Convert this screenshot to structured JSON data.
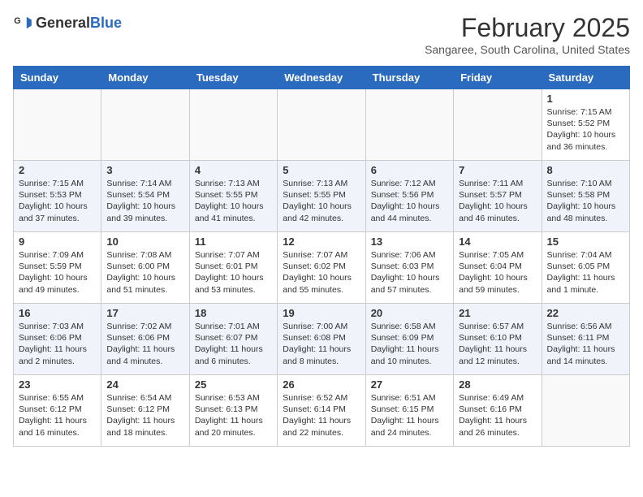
{
  "header": {
    "logo_general": "General",
    "logo_blue": "Blue",
    "month_year": "February 2025",
    "location": "Sangaree, South Carolina, United States"
  },
  "weekdays": [
    "Sunday",
    "Monday",
    "Tuesday",
    "Wednesday",
    "Thursday",
    "Friday",
    "Saturday"
  ],
  "weeks": [
    [
      {
        "day": "",
        "info": ""
      },
      {
        "day": "",
        "info": ""
      },
      {
        "day": "",
        "info": ""
      },
      {
        "day": "",
        "info": ""
      },
      {
        "day": "",
        "info": ""
      },
      {
        "day": "",
        "info": ""
      },
      {
        "day": "1",
        "info": "Sunrise: 7:15 AM\nSunset: 5:52 PM\nDaylight: 10 hours\nand 36 minutes."
      }
    ],
    [
      {
        "day": "2",
        "info": "Sunrise: 7:15 AM\nSunset: 5:53 PM\nDaylight: 10 hours\nand 37 minutes."
      },
      {
        "day": "3",
        "info": "Sunrise: 7:14 AM\nSunset: 5:54 PM\nDaylight: 10 hours\nand 39 minutes."
      },
      {
        "day": "4",
        "info": "Sunrise: 7:13 AM\nSunset: 5:55 PM\nDaylight: 10 hours\nand 41 minutes."
      },
      {
        "day": "5",
        "info": "Sunrise: 7:13 AM\nSunset: 5:55 PM\nDaylight: 10 hours\nand 42 minutes."
      },
      {
        "day": "6",
        "info": "Sunrise: 7:12 AM\nSunset: 5:56 PM\nDaylight: 10 hours\nand 44 minutes."
      },
      {
        "day": "7",
        "info": "Sunrise: 7:11 AM\nSunset: 5:57 PM\nDaylight: 10 hours\nand 46 minutes."
      },
      {
        "day": "8",
        "info": "Sunrise: 7:10 AM\nSunset: 5:58 PM\nDaylight: 10 hours\nand 48 minutes."
      }
    ],
    [
      {
        "day": "9",
        "info": "Sunrise: 7:09 AM\nSunset: 5:59 PM\nDaylight: 10 hours\nand 49 minutes."
      },
      {
        "day": "10",
        "info": "Sunrise: 7:08 AM\nSunset: 6:00 PM\nDaylight: 10 hours\nand 51 minutes."
      },
      {
        "day": "11",
        "info": "Sunrise: 7:07 AM\nSunset: 6:01 PM\nDaylight: 10 hours\nand 53 minutes."
      },
      {
        "day": "12",
        "info": "Sunrise: 7:07 AM\nSunset: 6:02 PM\nDaylight: 10 hours\nand 55 minutes."
      },
      {
        "day": "13",
        "info": "Sunrise: 7:06 AM\nSunset: 6:03 PM\nDaylight: 10 hours\nand 57 minutes."
      },
      {
        "day": "14",
        "info": "Sunrise: 7:05 AM\nSunset: 6:04 PM\nDaylight: 10 hours\nand 59 minutes."
      },
      {
        "day": "15",
        "info": "Sunrise: 7:04 AM\nSunset: 6:05 PM\nDaylight: 11 hours\nand 1 minute."
      }
    ],
    [
      {
        "day": "16",
        "info": "Sunrise: 7:03 AM\nSunset: 6:06 PM\nDaylight: 11 hours\nand 2 minutes."
      },
      {
        "day": "17",
        "info": "Sunrise: 7:02 AM\nSunset: 6:06 PM\nDaylight: 11 hours\nand 4 minutes."
      },
      {
        "day": "18",
        "info": "Sunrise: 7:01 AM\nSunset: 6:07 PM\nDaylight: 11 hours\nand 6 minutes."
      },
      {
        "day": "19",
        "info": "Sunrise: 7:00 AM\nSunset: 6:08 PM\nDaylight: 11 hours\nand 8 minutes."
      },
      {
        "day": "20",
        "info": "Sunrise: 6:58 AM\nSunset: 6:09 PM\nDaylight: 11 hours\nand 10 minutes."
      },
      {
        "day": "21",
        "info": "Sunrise: 6:57 AM\nSunset: 6:10 PM\nDaylight: 11 hours\nand 12 minutes."
      },
      {
        "day": "22",
        "info": "Sunrise: 6:56 AM\nSunset: 6:11 PM\nDaylight: 11 hours\nand 14 minutes."
      }
    ],
    [
      {
        "day": "23",
        "info": "Sunrise: 6:55 AM\nSunset: 6:12 PM\nDaylight: 11 hours\nand 16 minutes."
      },
      {
        "day": "24",
        "info": "Sunrise: 6:54 AM\nSunset: 6:12 PM\nDaylight: 11 hours\nand 18 minutes."
      },
      {
        "day": "25",
        "info": "Sunrise: 6:53 AM\nSunset: 6:13 PM\nDaylight: 11 hours\nand 20 minutes."
      },
      {
        "day": "26",
        "info": "Sunrise: 6:52 AM\nSunset: 6:14 PM\nDaylight: 11 hours\nand 22 minutes."
      },
      {
        "day": "27",
        "info": "Sunrise: 6:51 AM\nSunset: 6:15 PM\nDaylight: 11 hours\nand 24 minutes."
      },
      {
        "day": "28",
        "info": "Sunrise: 6:49 AM\nSunset: 6:16 PM\nDaylight: 11 hours\nand 26 minutes."
      },
      {
        "day": "",
        "info": ""
      }
    ]
  ]
}
